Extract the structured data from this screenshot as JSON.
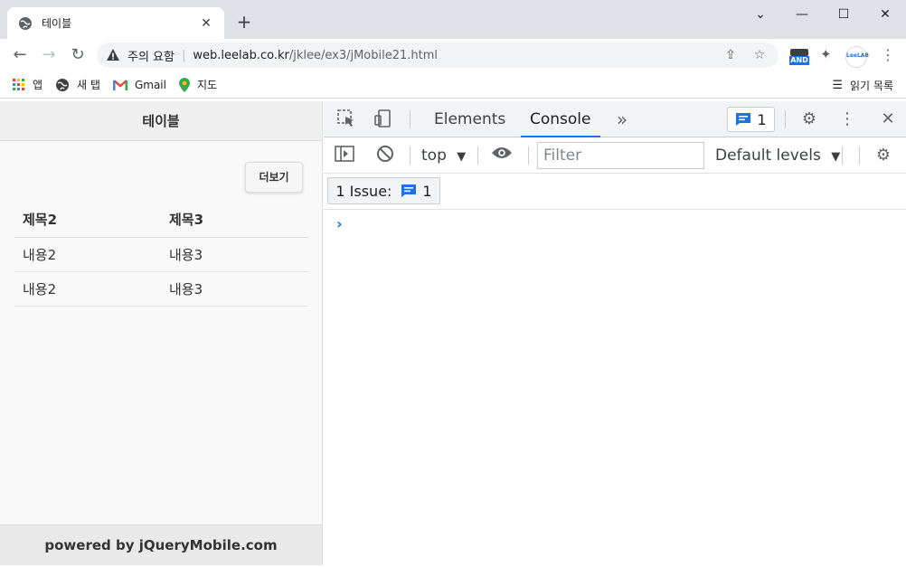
{
  "browser": {
    "tab_title": "테이블",
    "new_tab_label": "+",
    "address": {
      "warning_label": "주의 요함",
      "url_host": "web.leelab.co.kr",
      "url_path": "/jklee/ex3/jMobile21.html"
    },
    "extensions": {
      "and_label": "AND",
      "leelab_label": "LeeLAB"
    },
    "bookmarks": [
      {
        "label": "앱",
        "icon": "apps-grid-icon"
      },
      {
        "label": "새 탭",
        "icon": "globe-icon"
      },
      {
        "label": "Gmail",
        "icon": "gmail-icon"
      },
      {
        "label": "지도",
        "icon": "maps-pin-icon"
      }
    ],
    "reading_list_label": "읽기 목록"
  },
  "page": {
    "header_title": "테이블",
    "more_button": "더보기",
    "table": {
      "headers": [
        "제목2",
        "제목3"
      ],
      "rows": [
        [
          "내용2",
          "내용3"
        ],
        [
          "내용2",
          "내용3"
        ]
      ]
    },
    "footer": "powered by jQueryMobile.com"
  },
  "devtools": {
    "tabs": [
      "Elements",
      "Console"
    ],
    "active_tab": "Console",
    "issues_badge_count": "1",
    "context": "top",
    "filter_placeholder": "Filter",
    "levels": "Default levels",
    "issues_label": "1 Issue:",
    "issues_count": "1",
    "prompt": "›"
  },
  "colors": {
    "accent": "#1a73e8",
    "chrome_bg": "#dee1e6"
  }
}
